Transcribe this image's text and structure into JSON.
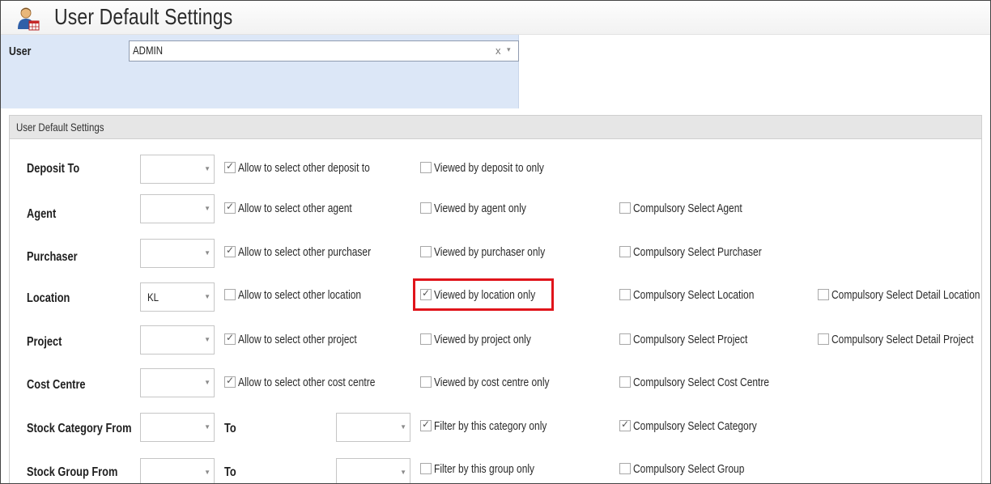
{
  "window": {
    "title": "User Default Settings",
    "icon": "user-settings-icon"
  },
  "user": {
    "label": "User",
    "value": "ADMIN",
    "clear_glyph": "x",
    "dropdown_glyph": "▾"
  },
  "group": {
    "header": "User Default Settings"
  },
  "rows": [
    {
      "label": "Deposit To",
      "combo": "",
      "allow": {
        "label": "Allow to select other deposit to",
        "checked": true
      },
      "viewed": {
        "label": "Viewed by deposit to only",
        "checked": false
      }
    },
    {
      "label": "Agent",
      "combo": "",
      "allow": {
        "label": "Allow to select other agent",
        "checked": true
      },
      "viewed": {
        "label": "Viewed by agent only",
        "checked": false
      },
      "compulsory": {
        "label": "Compulsory Select Agent",
        "checked": false
      }
    },
    {
      "label": "Purchaser",
      "combo": "",
      "allow": {
        "label": "Allow to select other purchaser",
        "checked": true
      },
      "viewed": {
        "label": "Viewed by purchaser only",
        "checked": false
      },
      "compulsory": {
        "label": "Compulsory Select Purchaser",
        "checked": false
      }
    },
    {
      "label": "Location",
      "combo": "KL",
      "allow": {
        "label": "Allow to select other location",
        "checked": false
      },
      "viewed": {
        "label": "Viewed by location only",
        "checked": true
      },
      "compulsory": {
        "label": "Compulsory Select Location",
        "checked": false
      },
      "compulsory_detail": {
        "label": "Compulsory Select Detail Location",
        "checked": false
      }
    },
    {
      "label": "Project",
      "combo": "",
      "allow": {
        "label": "Allow to select other project",
        "checked": true
      },
      "viewed": {
        "label": "Viewed by project only",
        "checked": false
      },
      "compulsory": {
        "label": "Compulsory Select Project",
        "checked": false
      },
      "compulsory_detail": {
        "label": "Compulsory Select Detail Project",
        "checked": false
      }
    },
    {
      "label": "Cost Centre",
      "combo": "",
      "allow": {
        "label": "Allow to select other cost centre",
        "checked": true
      },
      "viewed": {
        "label": "Viewed by cost centre only",
        "checked": false
      },
      "compulsory": {
        "label": "Compulsory Select Cost Centre",
        "checked": false
      }
    },
    {
      "label": "Stock Category From",
      "combo": "",
      "to_label": "To",
      "to_combo": "",
      "filter": {
        "label": "Filter by this category only",
        "checked": true
      },
      "compulsory": {
        "label": "Compulsory Select Category",
        "checked": true
      }
    },
    {
      "label": "Stock Group From",
      "combo": "",
      "to_label": "To",
      "to_combo": "",
      "filter": {
        "label": "Filter by this group only",
        "checked": false
      },
      "compulsory": {
        "label": "Compulsory Select Group",
        "checked": false
      }
    }
  ],
  "colors": {
    "highlight": "#e0141b",
    "user_band": "#dce7f7",
    "group_header": "#e6e6e6"
  }
}
